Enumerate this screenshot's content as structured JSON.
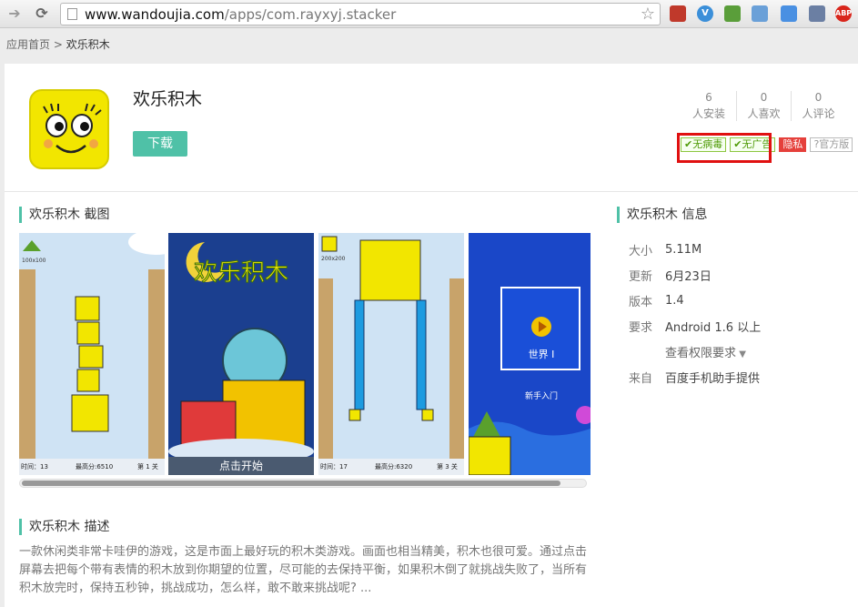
{
  "browser": {
    "url_domain": "www.wandoujia.com",
    "url_path": "/apps/com.rayxyj.stacker",
    "extensions": [
      "bookmark-icon",
      "v-icon",
      "evernote-icon",
      "image-icon",
      "doc-icon",
      "grid-icon",
      "adblock-icon"
    ],
    "abp_label": "ABP"
  },
  "breadcrumb": {
    "home": "应用首页",
    "sep": ">",
    "current": "欢乐积木"
  },
  "app": {
    "title": "欢乐积木",
    "download_label": "下载",
    "stats": [
      {
        "num": "6",
        "label": "人安装"
      },
      {
        "num": "0",
        "label": "人喜欢"
      },
      {
        "num": "0",
        "label": "人评论"
      }
    ],
    "badges": {
      "virus": "✔无病毒",
      "ads": "✔无广告",
      "privacy": "隐私",
      "official": "?官方版"
    }
  },
  "screenshots": {
    "heading": "欢乐积木 截图",
    "shot1": {
      "top_label": "100x100",
      "time": "时间：13",
      "best": "最高分:6510",
      "level": "第 1 关"
    },
    "shot2": {
      "title": "欢乐积木",
      "start": "点击开始"
    },
    "shot3": {
      "top_label": "200x200",
      "time": "时间：17",
      "best": "最高分:6320",
      "level": "第 3 关"
    },
    "shot4": {
      "world": "世界 I",
      "newbie": "新手入门"
    }
  },
  "description": {
    "heading": "欢乐积木 描述",
    "text": "一款休闲类非常卡哇伊的游戏，这是市面上最好玩的积木类游戏。画面也相当精美，积木也很可爱。通过点击屏幕去把每个带有表情的积木放到你期望的位置，尽可能的去保持平衡，如果积木倒了就挑战失败了，当所有积木放完时，保持五秒钟，挑战成功，怎么样，敢不敢来挑战呢? ..."
  },
  "info": {
    "heading": "欢乐积木 信息",
    "rows": [
      {
        "k": "大小",
        "v": "5.11M"
      },
      {
        "k": "更新",
        "v": "6月23日"
      },
      {
        "k": "版本",
        "v": "1.4"
      },
      {
        "k": "要求",
        "v": "Android 1.6 以上"
      },
      {
        "k": "",
        "v": "查看权限要求"
      },
      {
        "k": "来自",
        "v": "百度手机助手提供"
      }
    ]
  }
}
